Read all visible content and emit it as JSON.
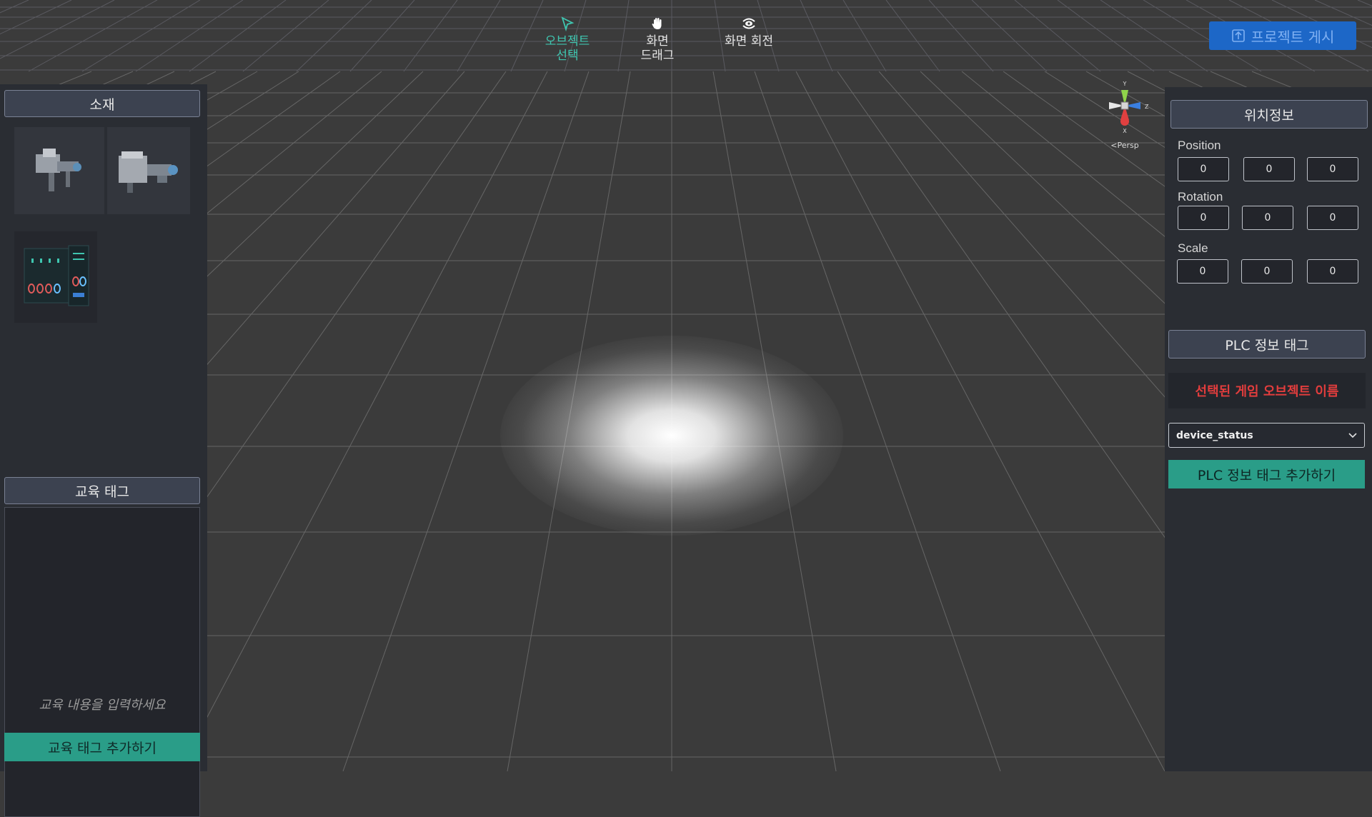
{
  "toolbar": {
    "tools": [
      {
        "label_line1": "오브젝트",
        "label_line2": "선택",
        "icon": "cursor-arrow-icon"
      },
      {
        "label_line1": "화면",
        "label_line2": "드래그",
        "icon": "hand-icon"
      },
      {
        "label_line1": "화면 회전",
        "label_line2": "",
        "icon": "rotate-eye-icon"
      }
    ],
    "publish_label": "프로젝트 게시",
    "publish_icon": "upload-icon"
  },
  "left_panel": {
    "materials_title": "소재",
    "materials": [
      {
        "icon": "machine-model-thumbnail-1"
      },
      {
        "icon": "machine-model-thumbnail-2"
      },
      {
        "icon": "control-panel-thumbnail"
      }
    ],
    "edu_tag_title": "교육 태그",
    "edu_placeholder": "교육 내용을 입력하세요",
    "edu_add_button": "교육 태그 추가하기"
  },
  "viewport": {
    "gizmo_labels": {
      "y": "Y",
      "z": "Z",
      "x": "X"
    },
    "persp_label": "<Persp"
  },
  "right_panel": {
    "location_title": "위치정보",
    "position_label": "Position",
    "position": [
      "0",
      "0",
      "0"
    ],
    "rotation_label": "Rotation",
    "rotation": [
      "0",
      "0",
      "0"
    ],
    "scale_label": "Scale",
    "scale": [
      "0",
      "0",
      "0"
    ],
    "plc_title": "PLC 정보 태그",
    "selected_object_name": "선택된 게임 오브젝트 이름",
    "dropdown_value": "device_status",
    "plc_add_button": "PLC 정보 태그 추가하기"
  },
  "colors": {
    "accent_green": "#2a9d88",
    "publish_blue": "#1d67c7",
    "alert_red": "#e23d3d",
    "active_tool": "#3fc6b0"
  }
}
